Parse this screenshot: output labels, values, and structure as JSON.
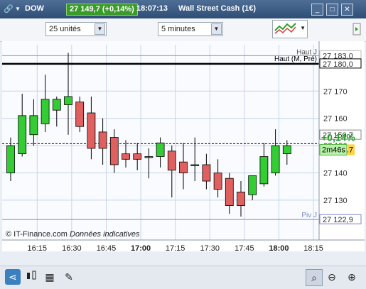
{
  "titlebar": {
    "instrument_code": "DOW",
    "price_badge": "27 149,7 (+0,14%)",
    "time": "18:07:13",
    "instrument_name": "Wall Street Cash (1€)"
  },
  "toolbar": {
    "units_select": "25 unités",
    "interval_select": "5 minutes"
  },
  "chart_data": {
    "type": "candlestick",
    "ylim": [
      27118,
      27187
    ],
    "yticks": [
      27130,
      27140,
      27150,
      27160,
      27170
    ],
    "xticks": [
      "16:15",
      "16:30",
      "16:45",
      "17:00",
      "17:15",
      "17:30",
      "17:45",
      "18:00",
      "18:15"
    ],
    "bold_xticks": [
      "17:00",
      "18:00"
    ],
    "candles": [
      {
        "o": 27140,
        "h": 27153,
        "l": 27137,
        "c": 27150
      },
      {
        "o": 27147,
        "h": 27169,
        "l": 27146,
        "c": 27161
      },
      {
        "o": 27154,
        "h": 27167,
        "l": 27150,
        "c": 27161
      },
      {
        "o": 27158,
        "h": 27176,
        "l": 27155,
        "c": 27167
      },
      {
        "o": 27163,
        "h": 27168,
        "l": 27157,
        "c": 27167
      },
      {
        "o": 27165,
        "h": 27184,
        "l": 27154,
        "c": 27168
      },
      {
        "o": 27166,
        "h": 27168,
        "l": 27155,
        "c": 27157
      },
      {
        "o": 27162,
        "h": 27168,
        "l": 27145,
        "c": 27149
      },
      {
        "o": 27155,
        "h": 27160,
        "l": 27143,
        "c": 27149
      },
      {
        "o": 27153,
        "h": 27156,
        "l": 27140,
        "c": 27143
      },
      {
        "o": 27147,
        "h": 27152,
        "l": 27142,
        "c": 27145
      },
      {
        "o": 27147,
        "h": 27151,
        "l": 27141,
        "c": 27145
      },
      {
        "o": 27146,
        "h": 27149,
        "l": 27138,
        "c": 27146
      },
      {
        "o": 27146,
        "h": 27153,
        "l": 27142,
        "c": 27151
      },
      {
        "o": 27148,
        "h": 27150,
        "l": 27131,
        "c": 27141
      },
      {
        "o": 27144,
        "h": 27151,
        "l": 27134,
        "c": 27140
      },
      {
        "o": 27143,
        "h": 27153,
        "l": 27137,
        "c": 27143
      },
      {
        "o": 27143,
        "h": 27147,
        "l": 27134,
        "c": 27137
      },
      {
        "o": 27140,
        "h": 27145,
        "l": 27131,
        "c": 27134
      },
      {
        "o": 27138,
        "h": 27140,
        "l": 27125,
        "c": 27128
      },
      {
        "o": 27133,
        "h": 27137,
        "l": 27124,
        "c": 27128
      },
      {
        "o": 27132,
        "h": 27139,
        "l": 27130,
        "c": 27139
      },
      {
        "o": 27136,
        "h": 27151,
        "l": 27135,
        "c": 27146
      },
      {
        "o": 27140,
        "h": 27156,
        "l": 27139,
        "c": 27150
      },
      {
        "o": 27147,
        "h": 27152,
        "l": 27143,
        "c": 27150
      }
    ],
    "levels": {
      "haut_j": {
        "label": "Haut J",
        "value": "27 183,0",
        "y": 27183.0
      },
      "haut_m_pre": {
        "label": "Haut (M, Pré)",
        "value": "27 180,0",
        "y": 27180.0
      },
      "last": {
        "value": "27 150,7",
        "y": 27150.7
      },
      "bas_j": {
        "label": "Piv J",
        "value": "27 122,9",
        "y": 27122.9
      }
    },
    "change_label": "+0,14%",
    "countdown_label": "2m46s",
    "countdown_suffix": ".7",
    "watermark": "© IT-Finance.com",
    "watermark_note": "Données indicatives",
    "colors": {
      "up": "#33cc33",
      "down": "#e06060",
      "line": "#000000",
      "bas": "#7b86c6"
    }
  }
}
